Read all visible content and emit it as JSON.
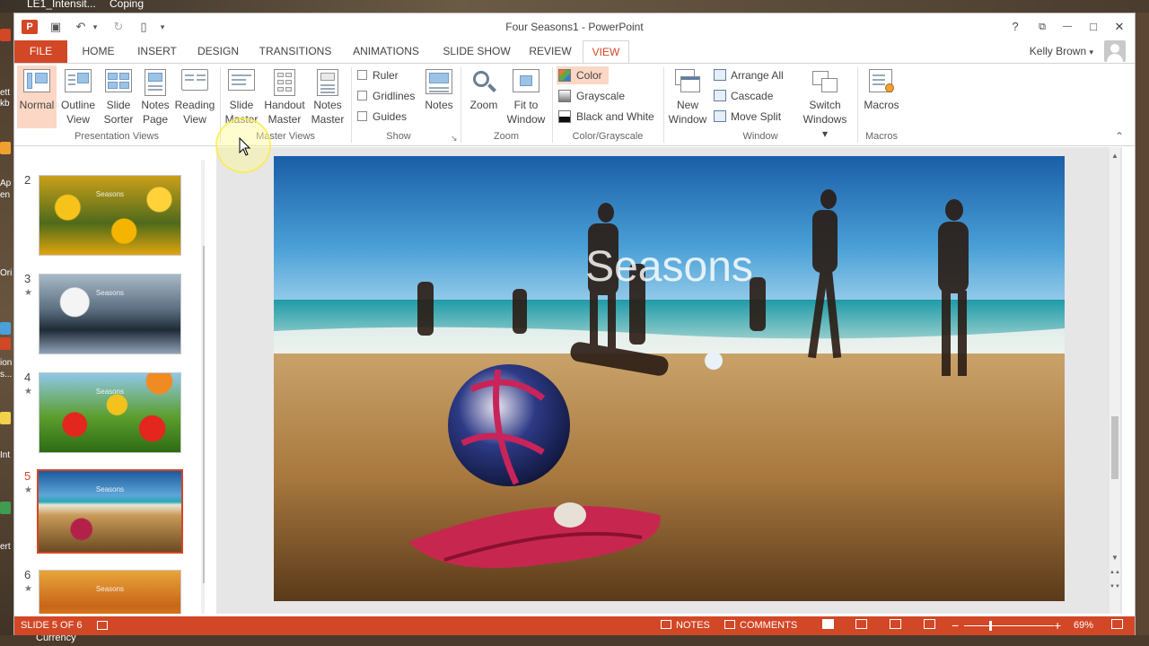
{
  "desktop": {
    "top_left_text": "LE1_Intensit...",
    "top_right_text": "Coping",
    "bottom_text": "Currency",
    "left_fragments": [
      "ett",
      "kb",
      "Ap",
      "en",
      "Ori",
      "ion",
      "s...",
      "Int",
      "ert"
    ]
  },
  "window": {
    "title": "Four Seasons1 - PowerPoint",
    "app_logo": "P",
    "quick_access": {
      "save_icon": "▣",
      "undo_icon": "↶",
      "redo_icon": "↻",
      "new_icon": "▯",
      "more_icon": "▾"
    },
    "controls": {
      "help": "?",
      "ribbon_display": "⧉",
      "minimize": "—",
      "maximize": "□",
      "close": "✕"
    }
  },
  "tabs": [
    "FILE",
    "HOME",
    "INSERT",
    "DESIGN",
    "TRANSITIONS",
    "ANIMATIONS",
    "SLIDE SHOW",
    "REVIEW",
    "VIEW"
  ],
  "user": {
    "name": "Kelly Brown",
    "caret": "▾"
  },
  "ribbon": {
    "presentation_views": {
      "label": "Presentation Views",
      "buttons": [
        {
          "line1": "Normal",
          "line2": ""
        },
        {
          "line1": "Outline",
          "line2": "View"
        },
        {
          "line1": "Slide",
          "line2": "Sorter"
        },
        {
          "line1": "Notes",
          "line2": "Page"
        },
        {
          "line1": "Reading",
          "line2": "View"
        }
      ]
    },
    "master_views": {
      "label": "Master Views",
      "buttons": [
        {
          "line1": "Slide",
          "line2": "Master"
        },
        {
          "line1": "Handout",
          "line2": "Master"
        },
        {
          "line1": "Notes",
          "line2": "Master"
        }
      ]
    },
    "show": {
      "label": "Show",
      "checks": [
        "Ruler",
        "Gridlines",
        "Guides"
      ],
      "notes": "Notes",
      "launcher": "↘"
    },
    "zoom": {
      "label": "Zoom",
      "zoom": "Zoom",
      "fit_line1": "Fit to",
      "fit_line2": "Window"
    },
    "color": {
      "label": "Color/Grayscale",
      "options": [
        "Color",
        "Grayscale",
        "Black and White"
      ],
      "swatch_colors": [
        "#e8772e",
        "#7f7f7f",
        "#111111"
      ]
    },
    "window_group": {
      "label": "Window",
      "new_line1": "New",
      "new_line2": "Window",
      "arrange_all": "Arrange All",
      "cascade": "Cascade",
      "move_split": "Move Split",
      "switch_line1": "Switch",
      "switch_line2": "Windows ▾"
    },
    "macros": {
      "label": "Macros",
      "button": "Macros"
    },
    "collapse": "⌃"
  },
  "thumbnails": [
    {
      "number": "2",
      "star": "",
      "title": "Seasons"
    },
    {
      "number": "3",
      "star": "★",
      "title": "Seasons"
    },
    {
      "number": "4",
      "star": "★",
      "title": "Seasons"
    },
    {
      "number": "5",
      "star": "★",
      "title": "Seasons"
    },
    {
      "number": "6",
      "star": "★",
      "title": "Seasons"
    }
  ],
  "slide": {
    "title": "Seasons"
  },
  "scroll": {
    "up": "▲",
    "down": "▼",
    "prev": "▲▲",
    "next": "▼▼"
  },
  "status": {
    "slide_info": "SLIDE 5 OF 6",
    "notes": "NOTES",
    "comments": "COMMENTS",
    "zoom_minus": "−",
    "zoom_plus": "+",
    "zoom_value": "69%"
  },
  "colors": {
    "accent": "#d24726",
    "selected_bg": "#fcd7c5"
  }
}
